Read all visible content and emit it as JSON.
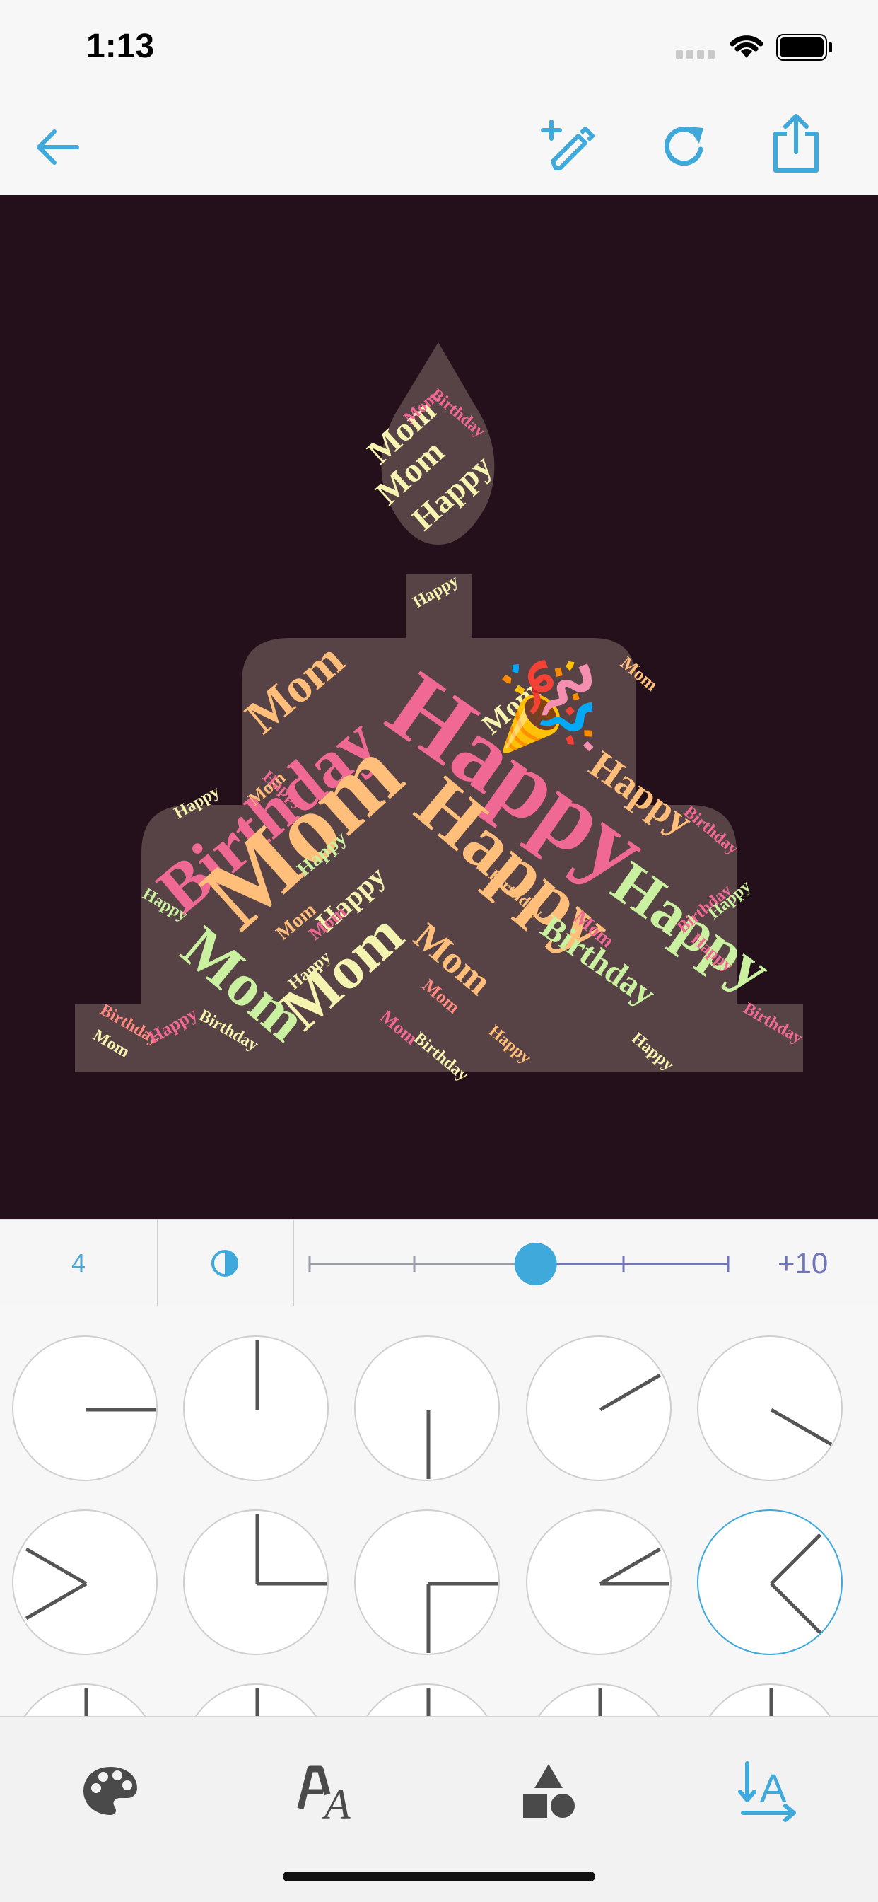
{
  "status_bar": {
    "time": "1:13"
  },
  "toolbar": {
    "back_icon": "arrow-left-icon",
    "edit_icon": "pencil-plus-icon",
    "refresh_icon": "refresh-icon",
    "share_icon": "share-icon",
    "accent": "#3fa9dc"
  },
  "canvas": {
    "background": "#24101a",
    "shape_fill": "#574246",
    "words": [
      {
        "text": "Happy",
        "color": "#f06995"
      },
      {
        "text": "Birthday",
        "color": "#f06995"
      },
      {
        "text": "Mom",
        "color": "#ffbe7a"
      },
      {
        "text": "Mom",
        "color": "#ffbe7a"
      },
      {
        "text": "Happy",
        "color": "#ffbe7a"
      },
      {
        "text": "Happy",
        "color": "#c9f19f"
      },
      {
        "text": "Mom",
        "color": "#c9f19f"
      },
      {
        "text": "Mom",
        "color": "#f5f3b0"
      },
      {
        "text": "Happy",
        "color": "#f5f3b0"
      },
      {
        "text": "Mom",
        "color": "#ffbe7a"
      },
      {
        "text": "Mom",
        "color": "#f5f3b0"
      },
      {
        "text": "Mom",
        "color": "#f5f3b0"
      },
      {
        "text": "Happy",
        "color": "#f5f3b0"
      },
      {
        "text": "Birthday",
        "color": "#f06995"
      },
      {
        "text": "Mom",
        "color": "#f06995"
      },
      {
        "text": "Happy",
        "color": "#ffbe7a"
      },
      {
        "text": "Birthday",
        "color": "#c9f19f"
      },
      {
        "text": "Happy",
        "color": "#c9f19f"
      },
      {
        "text": "Mom",
        "color": "#ff8a80"
      },
      {
        "text": "Mom",
        "color": "#f5f3b0"
      },
      {
        "text": "Happy",
        "color": "#f5f3b0"
      },
      {
        "text": "Birthday",
        "color": "#ff8a80"
      },
      {
        "text": "Happy",
        "color": "#f06995"
      },
      {
        "text": "Birthday",
        "color": "#f5f3b0"
      },
      {
        "text": "Mom",
        "color": "#f5f3b0"
      },
      {
        "text": "Happy",
        "color": "#f5f3b0"
      },
      {
        "text": "Birthday",
        "color": "#f06995"
      },
      {
        "text": "Happy",
        "color": "#f06995"
      },
      {
        "text": "Birthday",
        "color": "#f06995"
      },
      {
        "text": "Birthday",
        "color": "#f06995"
      },
      {
        "text": "Mom",
        "color": "#ffbe7a"
      },
      {
        "text": "Happy",
        "color": "#f5f3b0"
      },
      {
        "text": "Birthday",
        "color": "#ffbe7a"
      },
      {
        "text": "Mom",
        "color": "#f06995"
      },
      {
        "text": "Happy",
        "color": "#ffbe7a"
      },
      {
        "text": "Happy",
        "color": "#f5f3b0"
      },
      {
        "text": "Mom",
        "color": "#f06995"
      },
      {
        "text": "Mom",
        "color": "#ffbe7a"
      },
      {
        "text": "Happy",
        "color": "#f06995"
      },
      {
        "text": "Birthday",
        "color": "#f5f3b0"
      },
      {
        "text": "Happy",
        "color": "#c9f19f"
      },
      {
        "text": "Mom",
        "color": "#f06995"
      },
      {
        "text": "Mom",
        "color": "#ffbe7a"
      },
      {
        "text": "Happy",
        "color": "#c9f19f"
      }
    ],
    "emoji": "🎉"
  },
  "controls": {
    "count": "4",
    "opacity_icon": "opacity-drop-icon",
    "slider_value": "+10",
    "slider_fraction": 0.54,
    "slider_ticks": 5
  },
  "angle_grid": {
    "rows": [
      [
        {
          "angles": [
            0
          ]
        },
        {
          "angles": [
            90
          ]
        },
        {
          "angles": [
            270
          ]
        },
        {
          "angles": [
            30
          ]
        },
        {
          "angles": [
            -30
          ]
        }
      ],
      [
        {
          "angles": [
            150,
            210
          ]
        },
        {
          "angles": [
            90,
            0
          ]
        },
        {
          "angles": [
            0,
            270
          ]
        },
        {
          "angles": [
            0,
            30
          ]
        },
        {
          "angles": [
            45,
            -45
          ],
          "selected": true
        }
      ],
      [
        {
          "angles": [
            90
          ]
        },
        {
          "angles": [
            90
          ]
        },
        {
          "angles": [
            90
          ]
        },
        {
          "angles": [
            90
          ]
        },
        {
          "angles": [
            90
          ]
        }
      ]
    ]
  },
  "tabbar": {
    "tabs": [
      {
        "icon": "palette-icon",
        "active": false
      },
      {
        "icon": "font-icon",
        "active": false
      },
      {
        "icon": "shapes-icon",
        "active": false
      },
      {
        "icon": "text-orientation-icon",
        "active": true
      }
    ]
  }
}
